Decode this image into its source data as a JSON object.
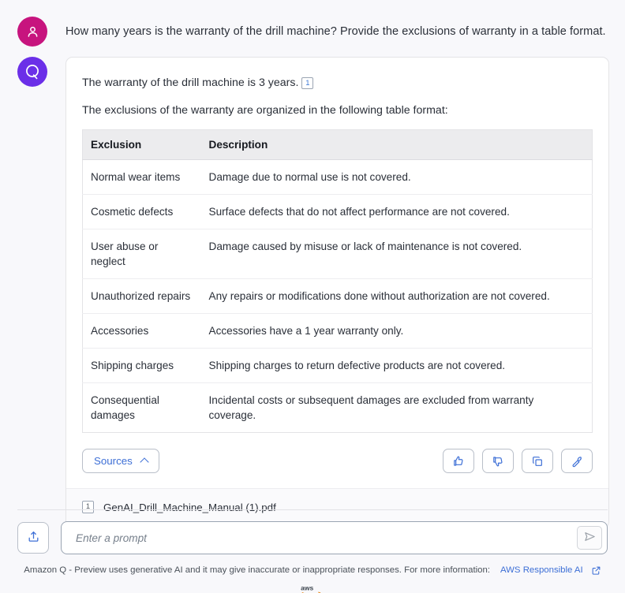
{
  "conversation": {
    "user_message": "How many years is the warranty of the drill machine? Provide the exclusions of warranty in a table format.",
    "assistant": {
      "paragraph_1": "The warranty of the drill machine is 3 years.",
      "paragraph_1_citation": "1",
      "paragraph_2": "The exclusions of the warranty are organized in the following table format:",
      "table": {
        "headers": [
          "Exclusion",
          "Description"
        ],
        "rows": [
          [
            "Normal wear items",
            "Damage due to normal use is not covered."
          ],
          [
            "Cosmetic defects",
            "Surface defects that do not affect performance are not covered."
          ],
          [
            "User abuse or neglect",
            "Damage caused by misuse or lack of maintenance is not covered."
          ],
          [
            "Unauthorized repairs",
            "Any repairs or modifications done without authorization are not covered."
          ],
          [
            "Accessories",
            "Accessories have a 1 year warranty only."
          ],
          [
            "Shipping charges",
            "Shipping charges to return defective products are not covered."
          ],
          [
            "Consequential damages",
            "Incidental costs or subsequent damages are excluded from warranty coverage."
          ]
        ]
      },
      "actions": {
        "sources_label": "Sources",
        "sources_chevron_icon": "chevron-up-icon",
        "thumbs_up_icon": "thumbs-up-icon",
        "thumbs_down_icon": "thumbs-down-icon",
        "copy_icon": "copy-icon",
        "wrench_icon": "wrench-icon"
      },
      "sources": [
        {
          "badge": "1",
          "name": "GenAI_Drill_Machine_Manual (1).pdf"
        }
      ]
    },
    "user_avatar_icon": "user-person-icon",
    "assistant_avatar_icon": "amazon-q-logo-icon"
  },
  "composer": {
    "upload_icon": "upload-icon",
    "placeholder": "Enter a prompt",
    "value": "",
    "send_icon": "send-paper-plane-icon"
  },
  "footer": {
    "disclaimer": "Amazon Q - Preview uses generative AI and it may give inaccurate or inappropriate responses. For more information:",
    "link_label": "AWS Responsible AI",
    "external_link_icon": "external-link-icon",
    "brand_logo": "aws-logo"
  },
  "colors": {
    "user_avatar": "#c7147e",
    "assistant_avatar": "#6b2fe8",
    "accent_link": "#3d6fd6",
    "page_background": "#f8f8fb",
    "card_background": "#ffffff",
    "table_header_background": "#ececee"
  }
}
